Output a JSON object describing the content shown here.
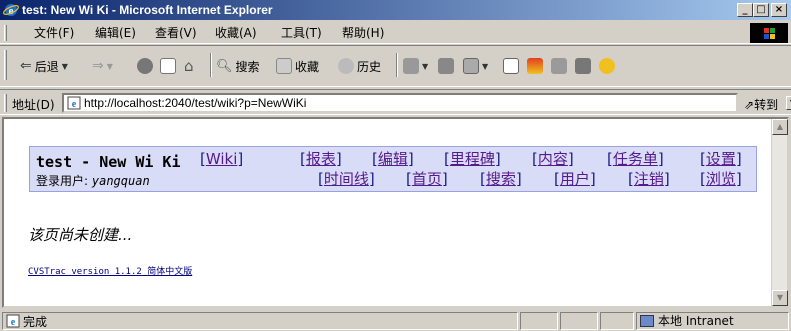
{
  "window": {
    "title": "test: New Wi Ki - Microsoft Internet Explorer",
    "caption_buttons": {
      "minimize": "_",
      "maximize": "□",
      "close": "×"
    }
  },
  "menu": [
    "文件(F)",
    "编辑(E)",
    "查看(V)",
    "收藏(A)",
    "工具(T)",
    "帮助(H)"
  ],
  "toolbar": {
    "back": "后退",
    "search": "搜索",
    "favorites": "收藏",
    "history": "历史"
  },
  "address": {
    "label": "地址(D)",
    "url": "http://localhost:2040/test/wiki?p=NewWiKi",
    "go": "转到"
  },
  "page": {
    "site_title": "test - New Wi Ki",
    "login_label": "登录用户:",
    "login_user": "yangquan",
    "nav": [
      "Wiki",
      "报表",
      "编辑",
      "里程碑",
      "内容",
      "任务单",
      "设置",
      "时间线",
      "首页",
      "搜索",
      "用户",
      "注销",
      "浏览"
    ],
    "notice": "该页尚未创建...",
    "footer": "CVSTrac version 1.1.2 简体中文版"
  },
  "status": {
    "text": "完成",
    "zone": "本地 Intranet"
  },
  "colors": {
    "titlebar_start": "#0a246a",
    "titlebar_end": "#a6caf0",
    "header_box_bg": "#d9dcf6",
    "link": "#551a8b"
  }
}
